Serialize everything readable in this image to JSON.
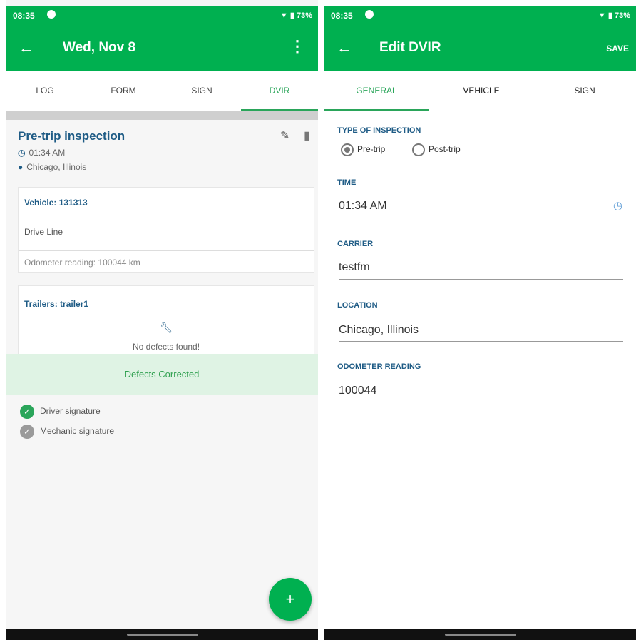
{
  "status": {
    "time": "08:35",
    "battery": "73%"
  },
  "left": {
    "title": "Wed, Nov 8",
    "tabs": [
      "LOG",
      "FORM",
      "SIGN",
      "DVIR"
    ],
    "inspection": {
      "title": "Pre-trip inspection",
      "time": "01:34 AM",
      "location": "Chicago, Illinois"
    },
    "vehicle_box": {
      "header": "Vehicle: 131313",
      "item": "Drive Line",
      "odometer": "Odometer reading: 100044 km"
    },
    "trailer_box": {
      "header": "Trailers: trailer1",
      "no_defects": "No defects found!"
    },
    "defects_bar": "Defects Corrected",
    "signatures": [
      "Driver signature",
      "Mechanic signature"
    ],
    "fab": "+"
  },
  "right": {
    "title": "Edit DVIR",
    "save": "SAVE",
    "tabs": [
      "GENERAL",
      "VEHICLE",
      "SIGN"
    ],
    "type_label": "TYPE OF INSPECTION",
    "radio_pre": "Pre-trip",
    "radio_post": "Post-trip",
    "time_label": "TIME",
    "time_value": "01:34 AM",
    "carrier_label": "CARRIER",
    "carrier_value": "testfm",
    "location_label": "LOCATION",
    "location_value": "Chicago, Illinois",
    "odometer_label": "ODOMETER READING",
    "odometer_value": "100044"
  },
  "icons": {
    "back": "←",
    "menu": "⋮",
    "edit": "✎",
    "delete": "🗑",
    "clock": "🕒",
    "pin": "📍",
    "wrench": "🔧",
    "check": "✓"
  },
  "colors": {
    "brand": "#00b050",
    "accent_blue": "#1e5b85"
  }
}
